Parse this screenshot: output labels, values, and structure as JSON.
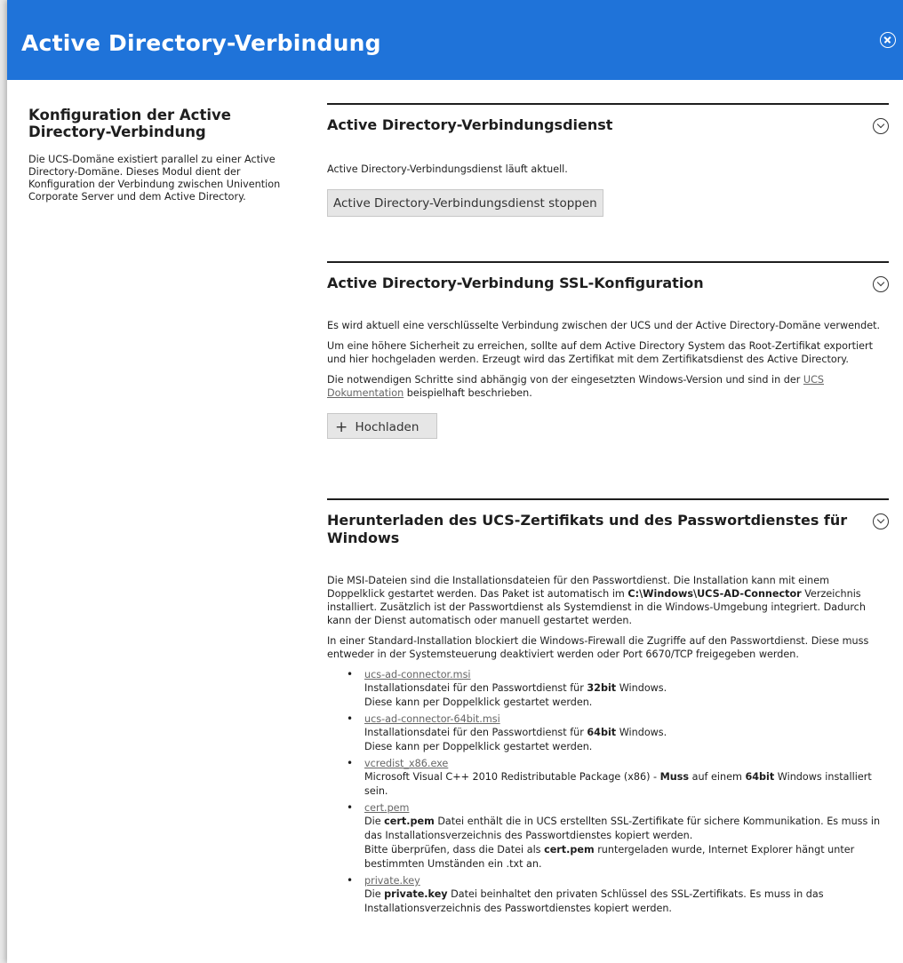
{
  "window": {
    "title": "Active Directory-Verbindung"
  },
  "sidebar": {
    "heading": "Konfiguration der Active Directory-Verbindung",
    "description": "Die UCS-Domäne existiert parallel zu einer Active Directory-Domäne. Dieses Modul dient der Konfiguration der Verbindung zwischen Univention Corporate Server und dem Active Directory."
  },
  "service_section": {
    "title": "Active Directory-Verbindungsdienst",
    "status": "Active Directory-Verbindungsdienst läuft aktuell.",
    "stop_button": "Active Directory-Verbindungsdienst stoppen"
  },
  "ssl_section": {
    "title": "Active Directory-Verbindung SSL-Konfiguration",
    "p1": "Es wird aktuell eine verschlüsselte Verbindung zwischen der UCS und der Active Directory-Domäne verwendet.",
    "p2": "Um eine höhere Sicherheit zu erreichen, sollte auf dem Active Directory System das Root-Zertifikat exportiert und hier hochgeladen werden. Erzeugt wird das Zertifikat mit dem Zertifikatsdienst des Active Directory.",
    "p3_before": "Die notwendigen Schritte sind abhängig von der eingesetzten Windows-Version und sind in der ",
    "p3_link": "UCS Dokumentation",
    "p3_after": " beispielhaft beschrieben.",
    "upload_icon": "plus-icon",
    "upload_button": "Hochladen"
  },
  "download_section": {
    "title": "Herunterladen des UCS-Zertifikats und des Passwortdienstes für Windows",
    "p1_a": "Die MSI-Dateien sind die Installationsdateien für den Passwortdienst. Die Installation kann mit einem Doppelklick gestartet werden. Das Paket ist automatisch im ",
    "p1_bold": "C:\\Windows\\UCS-AD-Connector",
    "p1_b": " Verzeichnis installiert. Zusätzlich ist der Passwortdienst als Systemdienst in die Windows-Umgebung integriert. Dadurch kann der Dienst automatisch oder manuell gestartet werden.",
    "p2": "In einer Standard-Installation blockiert die Windows-Firewall die Zugriffe auf den Passwortdienst. Diese muss entweder in der Systemsteuerung deaktiviert werden oder Port 6670/TCP freigegeben werden.",
    "files": [
      {
        "name": "ucs-ad-connector.msi",
        "line1_a": "Installationsdatei für den Passwortdienst für ",
        "line1_bold": "32bit",
        "line1_b": " Windows.",
        "line2": "Diese kann per Doppelklick gestartet werden."
      },
      {
        "name": "ucs-ad-connector-64bit.msi",
        "line1_a": "Installationsdatei für den Passwortdienst für ",
        "line1_bold": "64bit",
        "line1_b": " Windows.",
        "line2": "Diese kann per Doppelklick gestartet werden."
      },
      {
        "name": "vcredist_x86.exe",
        "line1_a": "Microsoft Visual C++ 2010 Redistributable Package (x86) - ",
        "line1_bold": "Muss",
        "line1_c": " auf einem ",
        "line1_bold2": "64bit",
        "line1_b": " Windows installiert sein."
      },
      {
        "name": "cert.pem",
        "line1_a": "Die ",
        "line1_bold": "cert.pem",
        "line1_b": " Datei enthält die in UCS erstellten SSL-Zertifikate für sichere Kommunikation. Es muss in das Installationsverzeichnis des Passwortdienstes kopiert werden.",
        "line2_a": "Bitte überprüfen, dass die Datei als ",
        "line2_bold": "cert.pem",
        "line2_b": " runtergeladen wurde, Internet Explorer hängt unter bestimmten Umständen ein .txt an."
      },
      {
        "name": "private.key",
        "line1_a": "Die ",
        "line1_bold": "private.key",
        "line1_b": " Datei beinhaltet den privaten Schlüssel des SSL-Zertifikats. Es muss in das Installationsverzeichnis des Passwortdienstes kopiert werden."
      }
    ]
  }
}
